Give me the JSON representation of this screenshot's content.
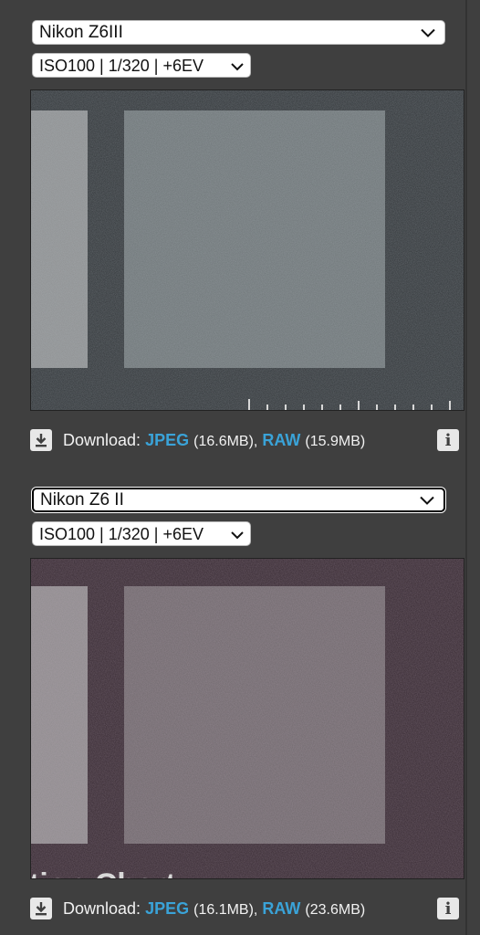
{
  "panels": [
    {
      "camera": "Nikon Z6III",
      "settings": "ISO100 | 1/320 | +6EV",
      "download_label": "Download:",
      "jpeg_label": "JPEG",
      "jpeg_size": "(16.6MB),",
      "raw_label": "RAW",
      "raw_size": "(15.9MB)",
      "info_label": "i"
    },
    {
      "camera": "Nikon Z6 II",
      "settings": "ISO100 | 1/320 | +6EV",
      "download_label": "Download:",
      "jpeg_label": "JPEG",
      "jpeg_size": "(16.1MB),",
      "raw_label": "RAW",
      "raw_size": "(23.6MB)",
      "info_label": "i",
      "overlay_text": "tion Chart"
    }
  ],
  "icons": {
    "chevron": "chevron-down-icon",
    "download": "download-icon",
    "info": "info-icon"
  },
  "colors": {
    "background": "#3f3f3f",
    "link": "#3aa3d8",
    "panel1_tint": "#2f3336",
    "panel2_tint": "#33262e"
  }
}
